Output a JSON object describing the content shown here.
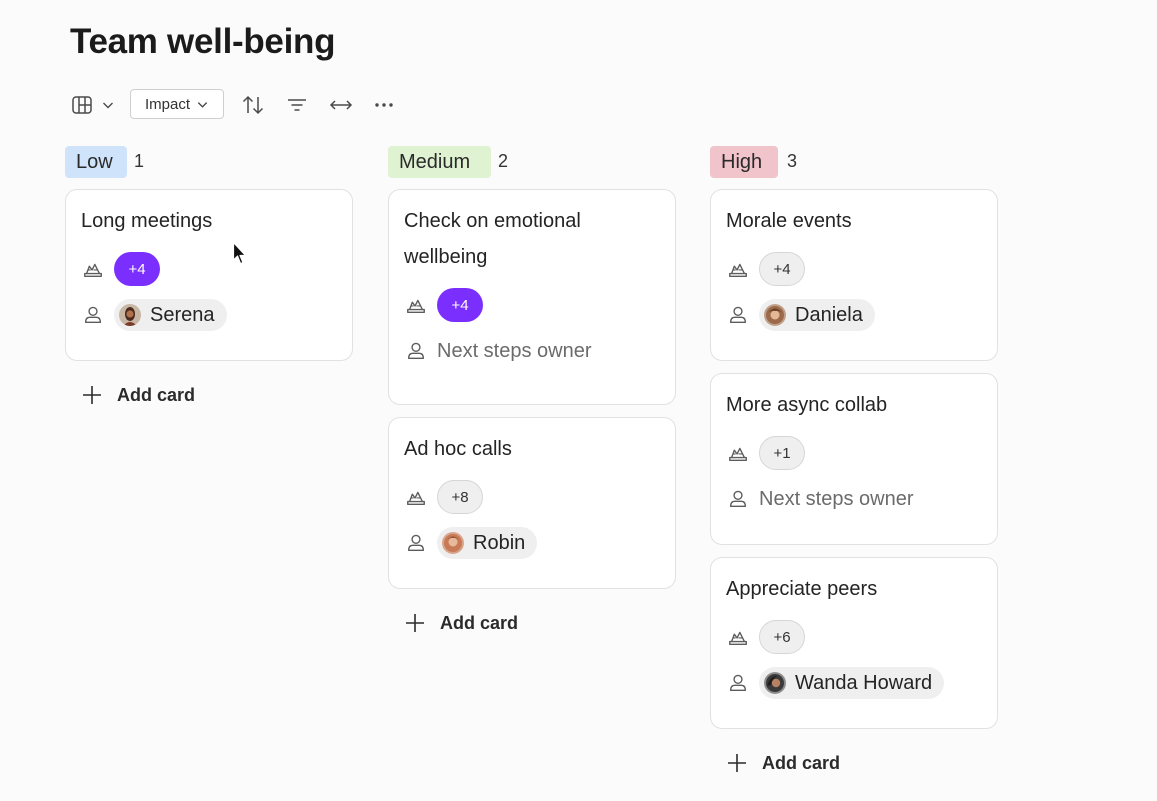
{
  "page": {
    "title": "Team well-being"
  },
  "toolbar": {
    "view_icon": "board-view-icon",
    "group_by_label": "Impact",
    "sort_icon": "sort-icon",
    "filter_icon": "filter-icon",
    "width_icon": "expand-width-icon",
    "more_icon": "more-icon"
  },
  "colors": {
    "low": "#cfe4fa",
    "medium": "#dff2d2",
    "high": "#f1c4cb",
    "accent_badge": "#7b2fff"
  },
  "columns": [
    {
      "name": "Low",
      "count": "1",
      "color": "#cfe4fa",
      "add_label": "Add card",
      "cards": [
        {
          "title": "Long meetings",
          "reactions": "+4",
          "owner": "Serena"
        }
      ]
    },
    {
      "name": "Medium",
      "count": "2",
      "color": "#dff2d2",
      "add_label": "Add card",
      "cards": [
        {
          "title": "Check on emotional wellbeing",
          "reactions": "+4",
          "owner_placeholder": "Next steps owner"
        },
        {
          "title": "Ad hoc calls",
          "reactions": "+8",
          "owner": "Robin"
        }
      ]
    },
    {
      "name": "High",
      "count": "3",
      "color": "#f1c4cb",
      "add_label": "Add card",
      "cards": [
        {
          "title": "Morale events",
          "reactions": "+4",
          "owner": "Daniela"
        },
        {
          "title": "More async collab",
          "reactions": "+1",
          "owner_placeholder": "Next steps owner"
        },
        {
          "title": "Appreciate peers",
          "reactions": "+6",
          "owner": "Wanda Howard"
        }
      ]
    }
  ]
}
